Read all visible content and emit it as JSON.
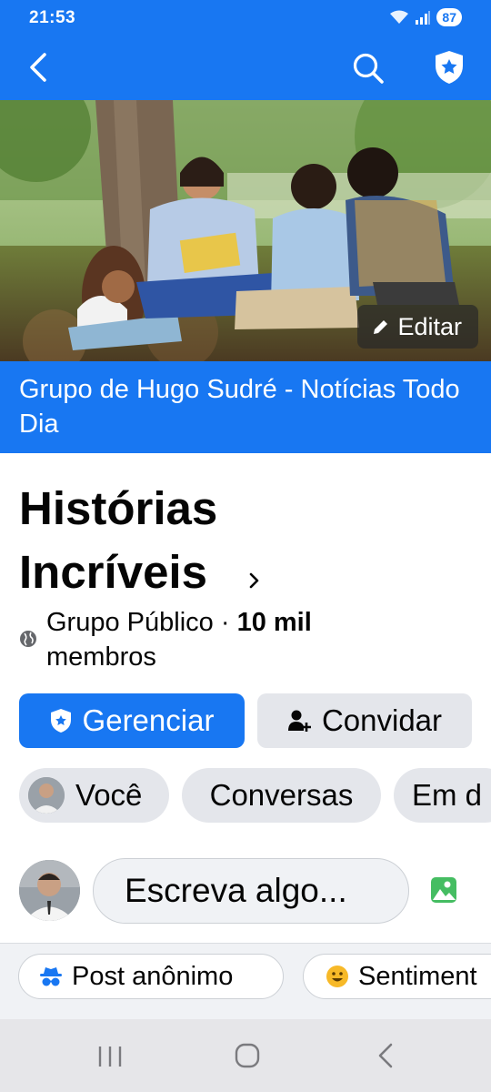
{
  "status_bar": {
    "time": "21:53",
    "battery": "87"
  },
  "cover": {
    "edit_label": "Editar"
  },
  "group_banner": {
    "text": "Grupo de Hugo Sudré - Notícias Todo Dia"
  },
  "group": {
    "title": "Histórias Incríveis",
    "type": "Grupo Público",
    "separator": " · ",
    "members": "10 mil",
    "members_suffix": "membros"
  },
  "actions": {
    "manage_label": "Gerenciar",
    "invite_label": "Convidar"
  },
  "tabs": [
    {
      "label": "Você"
    },
    {
      "label": "Conversas"
    },
    {
      "label": "Em d"
    }
  ],
  "composer": {
    "placeholder": "Escreva algo..."
  },
  "post_options": [
    {
      "label": "Post anônimo"
    },
    {
      "label": "Sentiment"
    }
  ],
  "colors": {
    "brand": "#1877f2",
    "chip_bg": "#e4e6eb",
    "tray_bg": "#f0f2f5"
  }
}
